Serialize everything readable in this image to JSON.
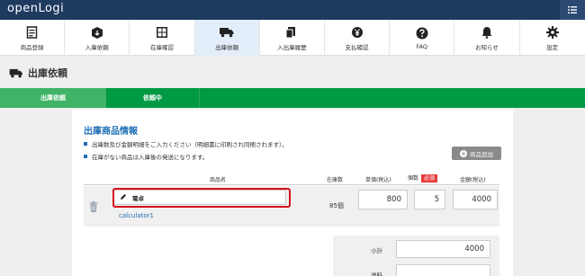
{
  "header": {
    "logo": "openLogi",
    "menu_icon": "list-icon"
  },
  "nav": [
    {
      "label": "商品登録",
      "icon": "product-register-icon"
    },
    {
      "label": "入庫依頼",
      "icon": "inbound-box-icon"
    },
    {
      "label": "在庫確認",
      "icon": "stock-shelf-icon"
    },
    {
      "label": "出庫依頼",
      "icon": "truck-icon",
      "active": true
    },
    {
      "label": "入出庫履歴",
      "icon": "history-doc-icon"
    },
    {
      "label": "支払確認",
      "icon": "yen-coin-icon"
    },
    {
      "label": "FAQ",
      "icon": "help-icon"
    },
    {
      "label": "お知らせ",
      "icon": "bell-icon"
    },
    {
      "label": "設定",
      "icon": "gear-icon"
    }
  ],
  "page": {
    "title": "出庫依頼",
    "title_icon": "truck-icon"
  },
  "steps": [
    {
      "label": "出庫依頼",
      "active": true
    },
    {
      "label": "依頼中",
      "active": false
    }
  ],
  "section": {
    "title": "出庫商品情報",
    "notes": [
      "出庫数及び金額明細をご入力ください（明細書に印刷され同梱されます）。",
      "在庫がない商品は入庫後の発送になります。"
    ],
    "add_button": "商品追加"
  },
  "table": {
    "headers": {
      "name": "商品名",
      "stock": "在庫数",
      "unit_price": "単価(税込)",
      "qty": "個数",
      "required": "必須",
      "amount": "金額(税込)"
    },
    "rows": [
      {
        "name": "電卓",
        "code": "calculator1",
        "stock": "85個",
        "unit_price": "800",
        "qty": "5",
        "amount": "4000"
      }
    ]
  },
  "summary": {
    "subtotal_label": "小計",
    "subtotal_value": "4000",
    "shipping_label": "送料"
  },
  "colors": {
    "header_bg": "#1e3a5f",
    "nav_active": "#e3eefa",
    "step_green": "#009a44",
    "step_active": "#3fb366",
    "accent_blue": "#1e6eb5",
    "required_red": "#e63c3c",
    "highlight_red": "#d5121e"
  }
}
